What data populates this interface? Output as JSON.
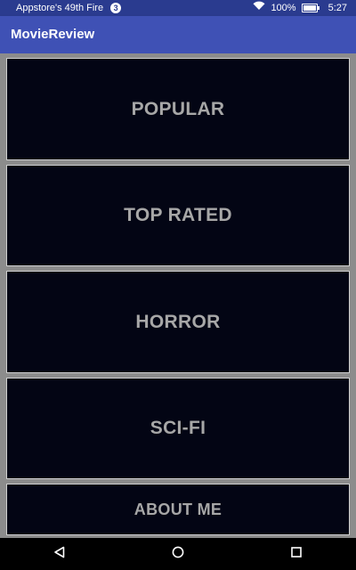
{
  "status_bar": {
    "carrier_text": "Appstore's 49th Fire",
    "notification_count": "3",
    "wifi_icon": "wifi-icon",
    "battery_percent": "100%",
    "battery_icon": "battery-charging-icon",
    "time": "5:27"
  },
  "app_bar": {
    "title": "MovieReview"
  },
  "categories": [
    {
      "label": "POPULAR"
    },
    {
      "label": "TOP RATED"
    },
    {
      "label": "HORROR"
    },
    {
      "label": "SCI-FI"
    },
    {
      "label": "ABOUT ME"
    }
  ],
  "nav_bar": {
    "back_icon": "back-triangle-icon",
    "home_icon": "home-circle-icon",
    "recent_icon": "recent-apps-square-icon"
  },
  "colors": {
    "status_bar_bg": "#2a3b8f",
    "app_bar_bg": "#3f51b5",
    "tile_bg": "#030514",
    "tile_text": "#a7a7a7",
    "list_bg": "#8c8c8c",
    "nav_bar_bg": "#000000"
  }
}
